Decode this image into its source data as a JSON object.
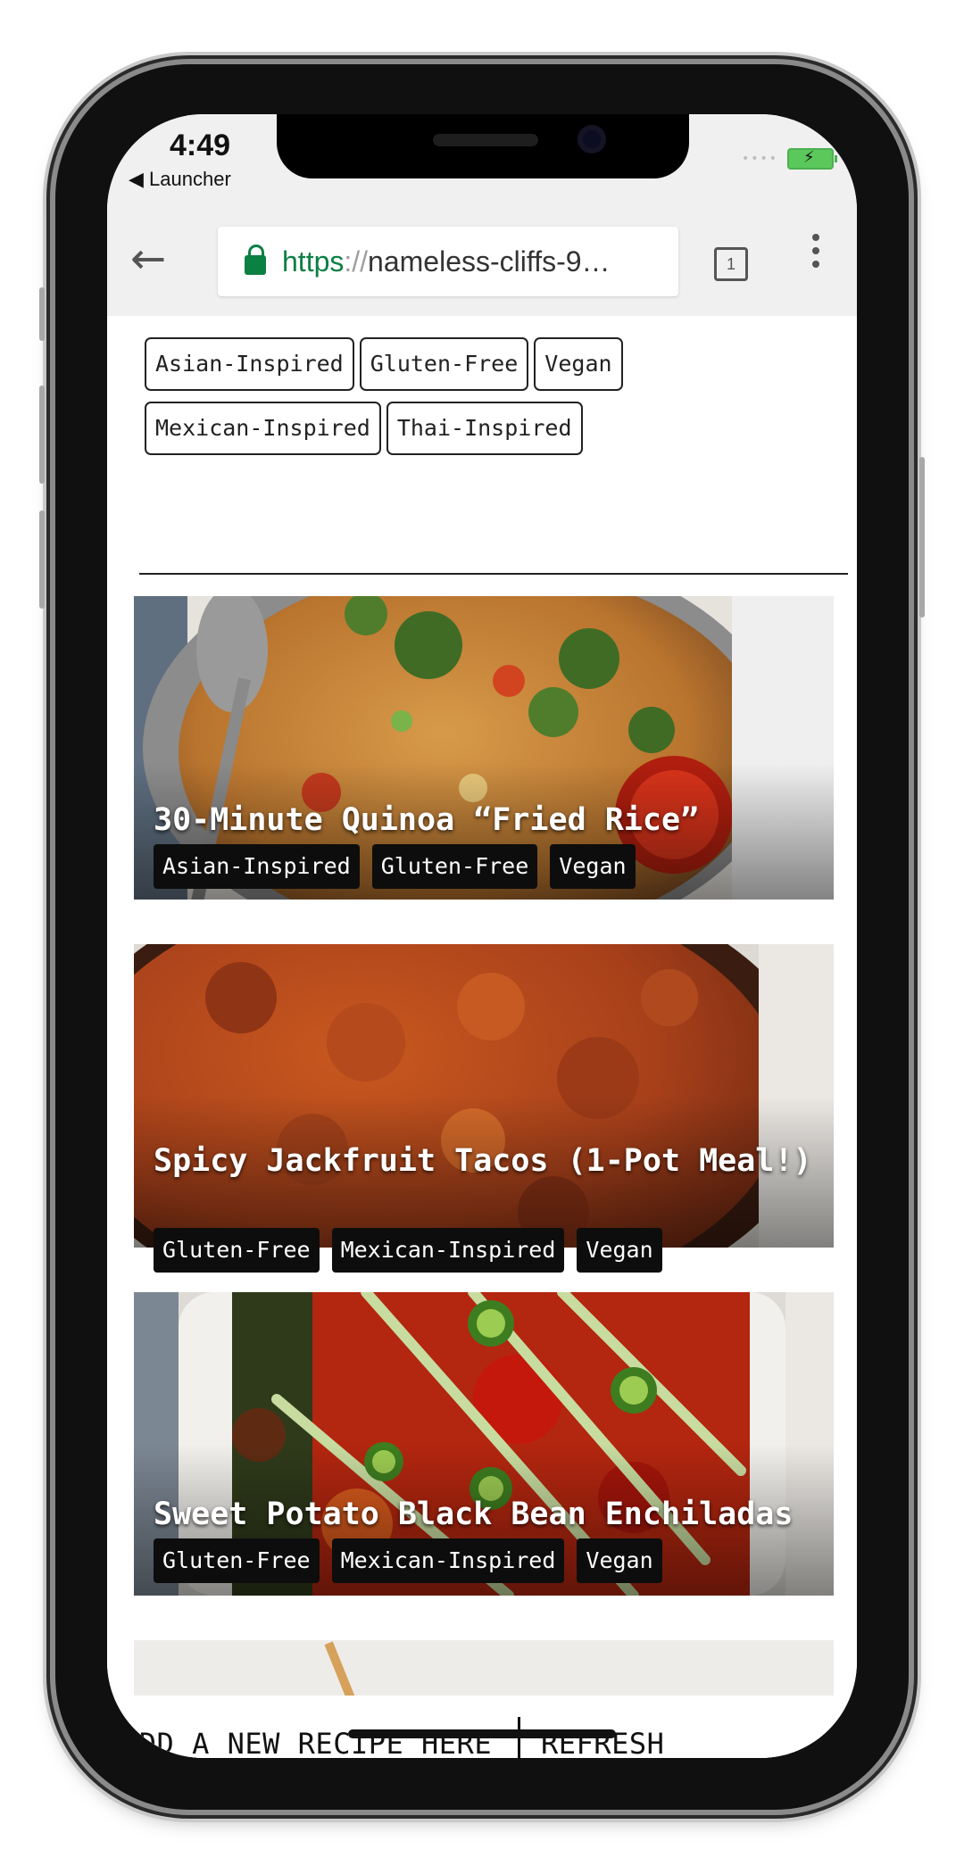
{
  "status_bar": {
    "time": "4:49",
    "back_app": "◀ Launcher"
  },
  "browser": {
    "url_scheme": "https",
    "url_separator": "://",
    "url_host": "nameless-cliffs-9…",
    "tab_count": "1"
  },
  "filters": [
    "Asian-Inspired",
    "Gluten-Free",
    "Vegan",
    "Mexican-Inspired",
    "Thai-Inspired"
  ],
  "recipes": [
    {
      "title": "30-Minute Quinoa “Fried Rice”",
      "tags": [
        "Asian-Inspired",
        "Gluten-Free",
        "Vegan"
      ]
    },
    {
      "title": "Spicy Jackfruit Tacos (1-Pot Meal!)",
      "tags": [
        "Gluten-Free",
        "Mexican-Inspired",
        "Vegan"
      ]
    },
    {
      "title": "Sweet Potato Black Bean Enchiladas",
      "tags": [
        "Gluten-Free",
        "Mexican-Inspired",
        "Vegan"
      ]
    }
  ],
  "actions": {
    "add_label": "ADD A NEW RECIPE HERE",
    "refresh_label": "REFRESH"
  },
  "colors": {
    "secure_green": "#0b8043",
    "tag_background": "#0d0d0d",
    "chrome_bar": "#f0f0f0"
  }
}
